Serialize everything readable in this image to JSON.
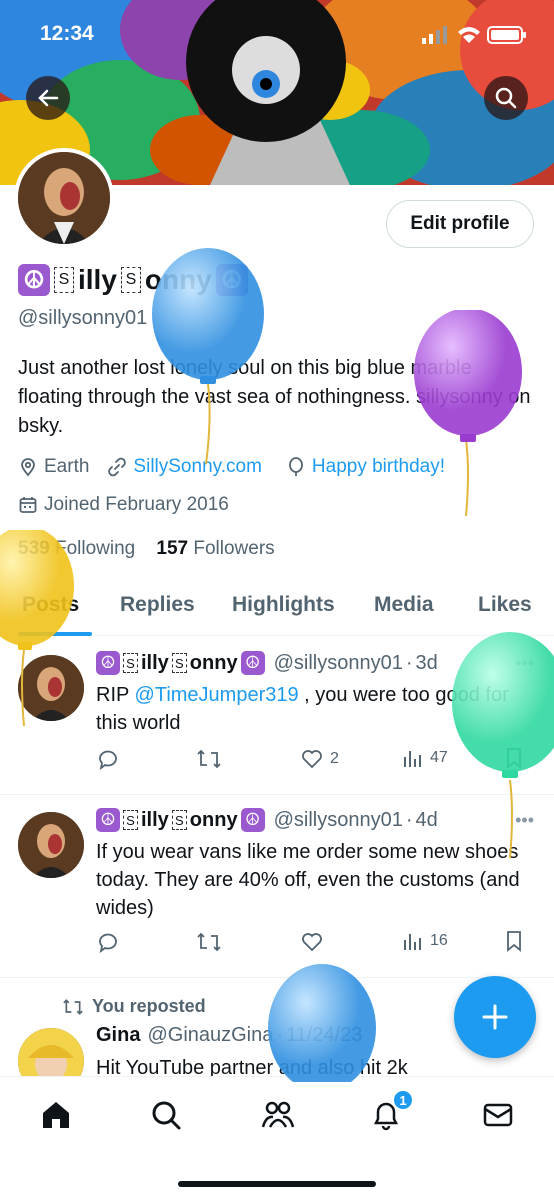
{
  "status_bar": {
    "time": "12:34"
  },
  "profile": {
    "name_parts": [
      "illy",
      "onny"
    ],
    "name_box_char": "S",
    "name_emoji": "☮",
    "handle": "@sillysonny01",
    "bio": "Just another lost lonely soul on this big blue marble floating through the vast sea of nothingness. sillysonny on bsky.",
    "location": "Earth",
    "website": "SillySonny.com",
    "birthday": "Happy birthday!",
    "joined": "Joined February 2016",
    "following_count": "539",
    "following_label": "Following",
    "followers_count": "157",
    "followers_label": "Followers",
    "edit_button": "Edit profile"
  },
  "tabs": [
    "Posts",
    "Replies",
    "Highlights",
    "Media",
    "Likes"
  ],
  "posts": [
    {
      "name_parts": [
        "illy",
        "onny"
      ],
      "handle": "@sillysonny01",
      "time": "3d",
      "text_prefix": "RIP ",
      "mention": "@TimeJumper319",
      "text_suffix": " , you were too good for this world",
      "likes": "2",
      "views": "47"
    },
    {
      "name_parts": [
        "illy",
        "onny"
      ],
      "handle": "@sillysonny01",
      "time": "4d",
      "text": "If you wear vans like me order some new shoes today. They are 40% off, even the customs (and wides)",
      "likes": "",
      "views": "16"
    },
    {
      "repost_label": "You reposted",
      "name": "Gina",
      "handle": "@GinauzGina",
      "time": "11/24/23",
      "text": "Hit YouTube partner and also hit 2k"
    }
  ],
  "nav": {
    "notifications_badge": "1"
  },
  "colors": {
    "accent": "#1d9bf0",
    "balloon_blue": "#4aa8f0",
    "balloon_purple": "#a84fd6",
    "balloon_yellow": "#f6cf2c",
    "balloon_green": "#3ee6b0"
  }
}
